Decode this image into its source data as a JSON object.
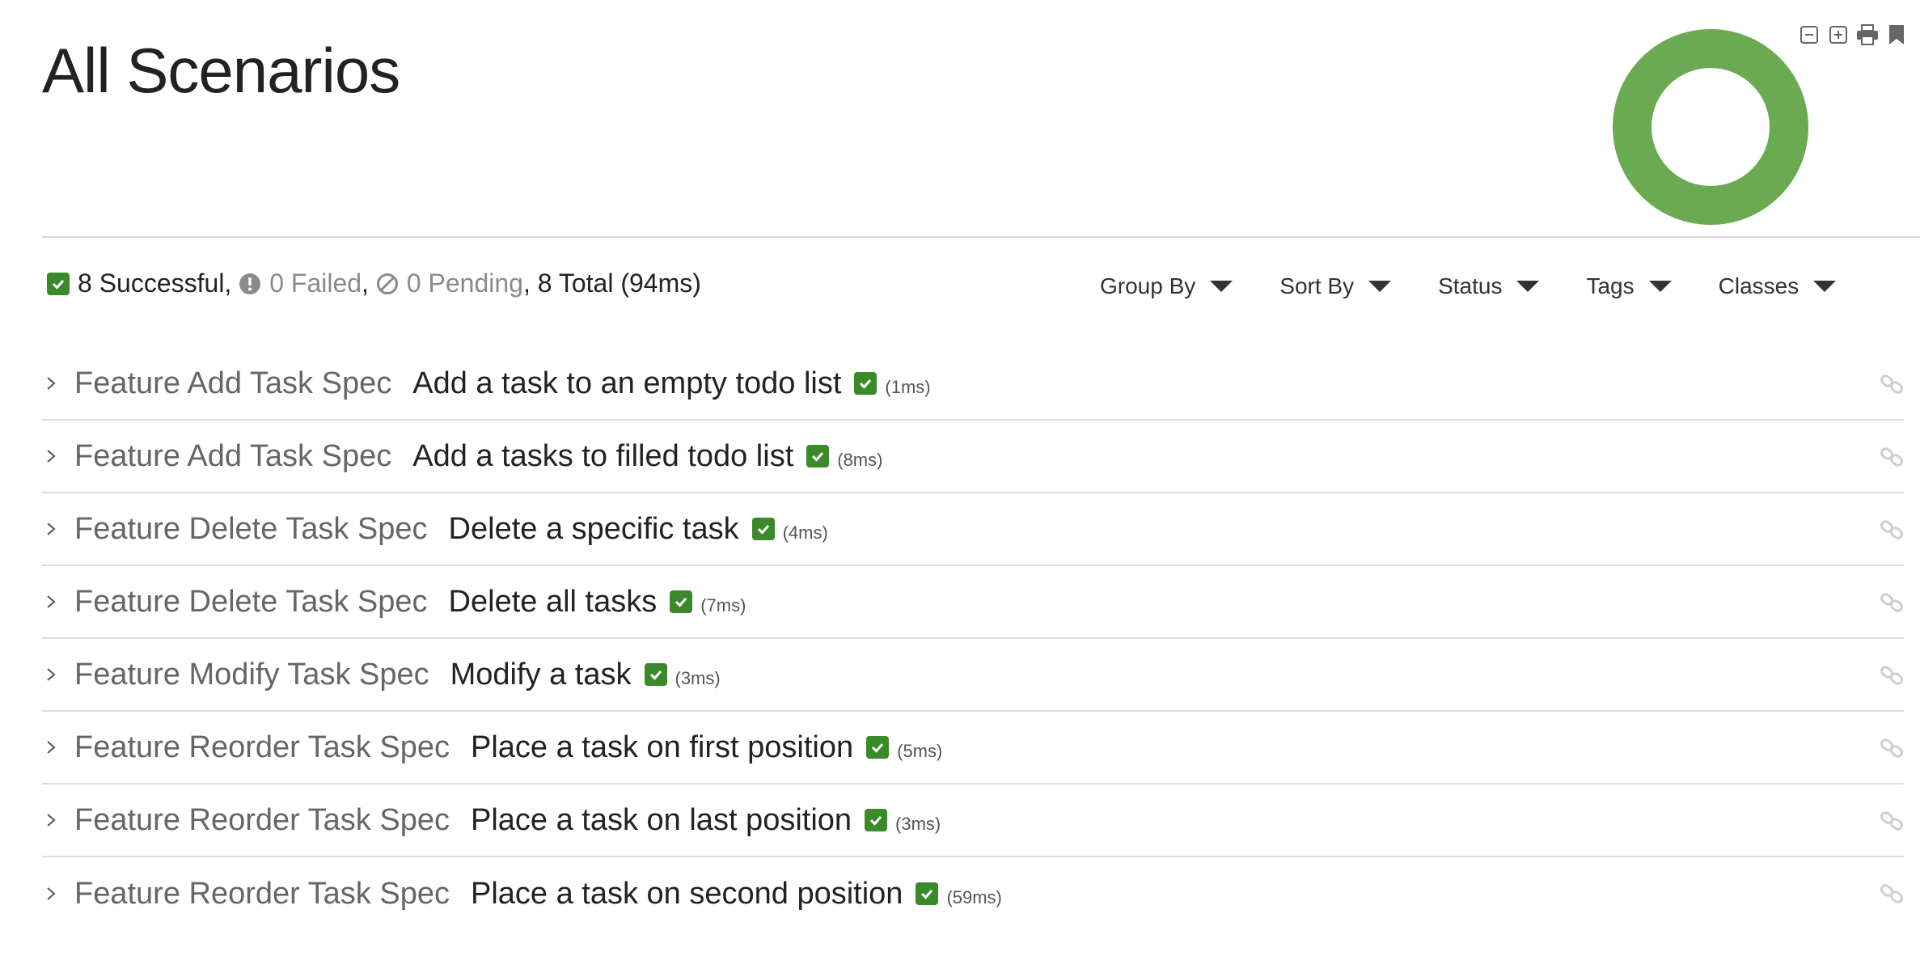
{
  "page": {
    "title": "All Scenarios"
  },
  "toolbar": {
    "icons": [
      "collapse-all-icon",
      "expand-all-icon",
      "print-icon",
      "bookmark-icon"
    ]
  },
  "donut": {
    "successful": 8,
    "failed": 0,
    "pending": 0,
    "colors": {
      "successful": "#6aab52"
    }
  },
  "summary": {
    "successful": "8 Successful",
    "failed": "0 Failed",
    "pending": "0 Pending",
    "total": "8 Total (94ms)",
    "sep": ",",
    "sep2": ",",
    "sep3": ","
  },
  "filters": [
    {
      "label": "Group By"
    },
    {
      "label": "Sort By"
    },
    {
      "label": "Status"
    },
    {
      "label": "Tags"
    },
    {
      "label": "Classes"
    }
  ],
  "scenarios": [
    {
      "feature": "Feature Add Task Spec",
      "scenario": "Add a task to an empty todo list",
      "duration": "(1ms)"
    },
    {
      "feature": "Feature Add Task Spec",
      "scenario": "Add a tasks to filled todo list",
      "duration": "(8ms)"
    },
    {
      "feature": "Feature Delete Task Spec",
      "scenario": "Delete a specific task",
      "duration": "(4ms)"
    },
    {
      "feature": "Feature Delete Task Spec",
      "scenario": "Delete all tasks",
      "duration": "(7ms)"
    },
    {
      "feature": "Feature Modify Task Spec",
      "scenario": "Modify a task",
      "duration": "(3ms)"
    },
    {
      "feature": "Feature Reorder Task Spec",
      "scenario": "Place a task on first position",
      "duration": "(5ms)"
    },
    {
      "feature": "Feature Reorder Task Spec",
      "scenario": "Place a task on last position",
      "duration": "(3ms)"
    },
    {
      "feature": "Feature Reorder Task Spec",
      "scenario": "Place a task on second position",
      "duration": "(59ms)"
    }
  ],
  "colors": {
    "success": "#3a8a2a",
    "muted": "#8a8a8a",
    "rule": "#dddddd"
  }
}
